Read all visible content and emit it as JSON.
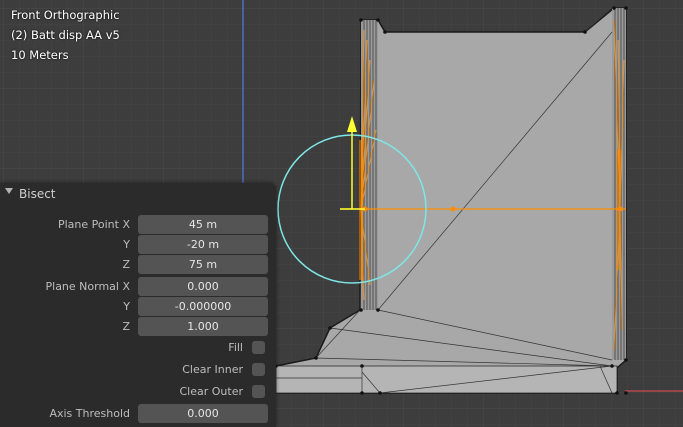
{
  "viewport": {
    "view_name": "Front Orthographic",
    "object_name": "(2) Batt disp AA v5",
    "scale": "10 Meters"
  },
  "bisect_panel": {
    "title": "Bisect",
    "plane_point": {
      "x_label": "Plane Point X",
      "x_value": "45 m",
      "y_label": "Y",
      "y_value": "-20 m",
      "z_label": "Z",
      "z_value": "75 m"
    },
    "plane_normal": {
      "x_label": "Plane Normal X",
      "x_value": "0.000",
      "y_label": "Y",
      "y_value": "-0.000000",
      "z_label": "Z",
      "z_value": "1.000"
    },
    "fill_label": "Fill",
    "clear_inner_label": "Clear Inner",
    "clear_outer_label": "Clear Outer",
    "axis_threshold_label": "Axis Threshold",
    "axis_threshold_value": "0.000"
  },
  "colors": {
    "background": "#3d3d3d",
    "mesh_face": "#a8a8a8",
    "selection": "#ff8c00",
    "gizmo_circle": "#7fe6e6",
    "gizmo_arrow": "#ffff33",
    "z_axis": "#4f6fbf",
    "x_axis": "#b34a4a"
  }
}
